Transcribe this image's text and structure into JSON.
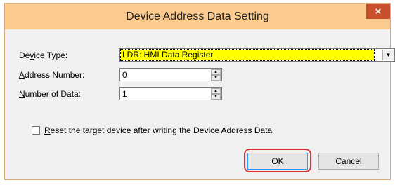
{
  "window": {
    "title": "Device Address Data Setting",
    "close_symbol": "×"
  },
  "form": {
    "device_type": {
      "label_pre": "De",
      "label_u": "v",
      "label_post": "ice Type:",
      "value": "LDR: HMI Data Register",
      "dropdown_icon": "chevron-down-icon"
    },
    "address_number": {
      "label_u": "A",
      "label_post": "ddress Number:",
      "value": "0"
    },
    "number_of_data": {
      "label_u": "N",
      "label_post": "umber of Data:",
      "value": "1"
    },
    "reset_checkbox": {
      "checked": false,
      "label_u": "R",
      "label_post": "eset the target device after writing the Device Address Data"
    }
  },
  "buttons": {
    "ok": "OK",
    "cancel": "Cancel"
  },
  "colors": {
    "titlebar": "#fbcb8f",
    "close": "#c7502f",
    "highlight": "#ffff00",
    "ok_outline": "#d7313e"
  }
}
